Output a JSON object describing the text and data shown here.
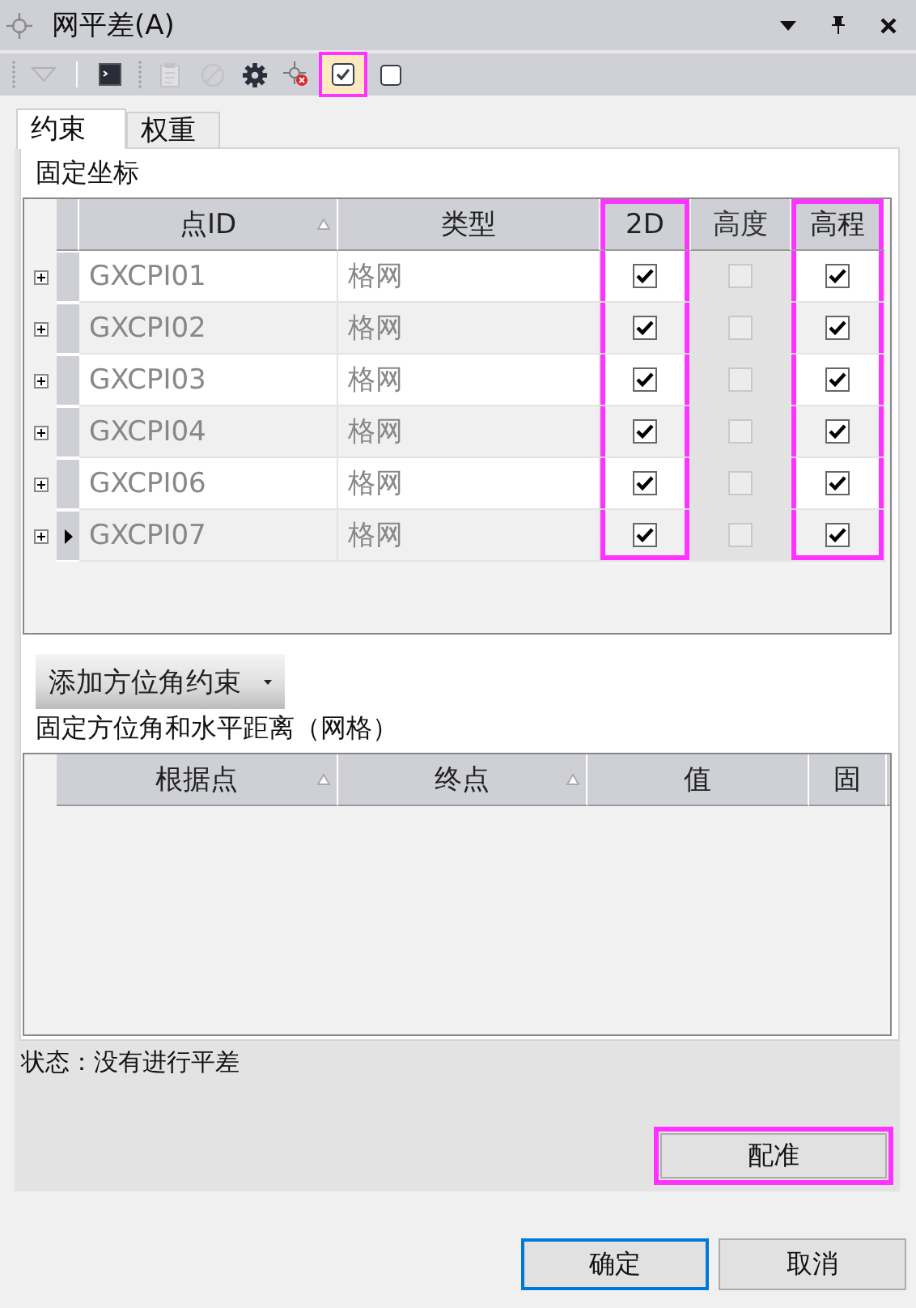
{
  "window": {
    "title": "网平差(A)"
  },
  "toolbar": [
    {
      "kind": "dropdown",
      "highlighted": false,
      "disabled": true
    },
    {
      "kind": "console",
      "highlighted": false,
      "disabled": false
    },
    {
      "kind": "clipboard",
      "highlighted": false,
      "disabled": true
    },
    {
      "kind": "cancel",
      "highlighted": false,
      "disabled": true
    },
    {
      "kind": "gear",
      "highlighted": false,
      "disabled": false
    },
    {
      "kind": "point-remove",
      "highlighted": false,
      "disabled": false
    },
    {
      "kind": "check-all",
      "highlighted": true,
      "disabled": false
    },
    {
      "kind": "checkbox",
      "highlighted": false,
      "disabled": false,
      "checked": false
    }
  ],
  "tabs": [
    {
      "label": "约束",
      "selected": true
    },
    {
      "label": "权重",
      "selected": false
    }
  ],
  "fixed_coordinates": {
    "title": "固定坐标",
    "columns": [
      {
        "label": "点ID",
        "sortable": true,
        "highlighted": false,
        "disabled": false
      },
      {
        "label": "类型",
        "sortable": false,
        "highlighted": false,
        "disabled": false
      },
      {
        "label": "2D",
        "sortable": false,
        "highlighted": true,
        "disabled": false
      },
      {
        "label": "高度",
        "sortable": false,
        "highlighted": false,
        "disabled": true
      },
      {
        "label": "高程",
        "sortable": false,
        "highlighted": true,
        "disabled": false
      }
    ],
    "rows": [
      {
        "point_id": "GXCPI01",
        "type": "格网",
        "checks": [
          true,
          false,
          true
        ],
        "current": false
      },
      {
        "point_id": "GXCPI02",
        "type": "格网",
        "checks": [
          true,
          false,
          true
        ],
        "current": false
      },
      {
        "point_id": "GXCPI03",
        "type": "格网",
        "checks": [
          true,
          false,
          true
        ],
        "current": false
      },
      {
        "point_id": "GXCPI04",
        "type": "格网",
        "checks": [
          true,
          false,
          true
        ],
        "current": false
      },
      {
        "point_id": "GXCPI06",
        "type": "格网",
        "checks": [
          true,
          false,
          true
        ],
        "current": false
      },
      {
        "point_id": "GXCPI07",
        "type": "格网",
        "checks": [
          true,
          false,
          true
        ],
        "current": true
      }
    ]
  },
  "add_button": {
    "label": "添加方位角约束"
  },
  "fixed_azimuth": {
    "title": "固定方位角和水平距离（网格）",
    "columns": [
      {
        "label": "根据点",
        "sortable": true
      },
      {
        "label": "终点",
        "sortable": true
      },
      {
        "label": "值",
        "sortable": false
      },
      {
        "label": "固",
        "sortable": false
      }
    ]
  },
  "status": {
    "text": "状态：没有进行平差"
  },
  "register_button": {
    "label": "配准",
    "highlighted": true
  },
  "buttons": [
    {
      "label": "确定",
      "default": true
    },
    {
      "label": "取消",
      "default": false
    }
  ]
}
